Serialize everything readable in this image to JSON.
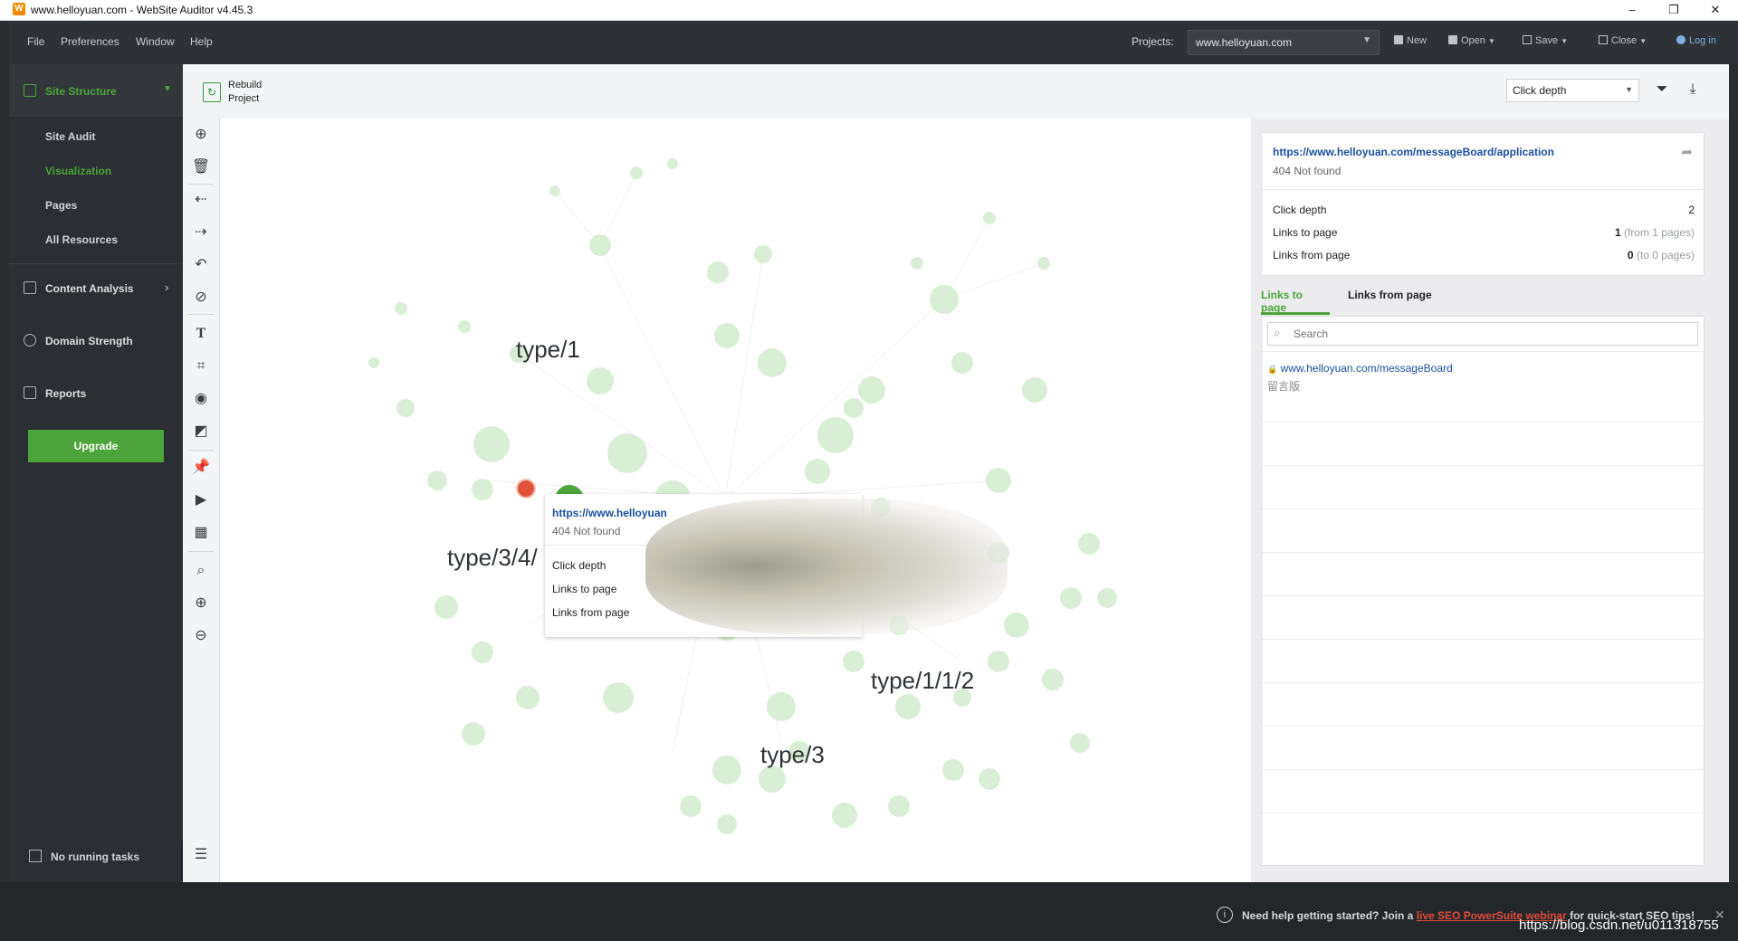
{
  "window": {
    "title": "www.helloyuan.com - WebSite Auditor v4.45.3",
    "app_icon": "W",
    "minimize_icon": "–",
    "restore_icon": "❐",
    "close_icon": "✕"
  },
  "menu": {
    "items": [
      "File",
      "Preferences",
      "Window",
      "Help"
    ],
    "projects_label": "Projects:",
    "project_value": "www.helloyuan.com",
    "toolbar": {
      "new": "New",
      "open": "Open",
      "save": "Save",
      "close": "Close",
      "login": "Log in"
    }
  },
  "sidebar": {
    "site_structure": "Site Structure",
    "sub_items": [
      "Site Audit",
      "Visualization",
      "Pages",
      "All Resources"
    ],
    "active_sub": "Visualization",
    "content_analysis": "Content Analysis",
    "domain_strength": "Domain Strength",
    "reports": "Reports",
    "upgrade": "Upgrade",
    "tasks": "No running tasks",
    "collapse_icon": "‹"
  },
  "header": {
    "rebuild": "Rebuild\nProject",
    "view_select": "Click depth"
  },
  "graph": {
    "labels": [
      "type/1",
      "type/3/4/",
      "type/1/1/2",
      "type/3"
    ],
    "tooltip": {
      "url": "https://www.helloyuan",
      "status": "404 Not found",
      "rows": [
        "Click depth",
        "Links to page",
        "Links from page"
      ]
    }
  },
  "details": {
    "url": "https://www.helloyuan.com/messageBoard/application",
    "status": "404 Not found",
    "rows": [
      {
        "label": "Click depth",
        "value": "2",
        "note": ""
      },
      {
        "label": "Links to page",
        "value": "1",
        "note": "(from 1 pages)"
      },
      {
        "label": "Links from page",
        "value": "0",
        "note": "(to 0 pages)"
      }
    ],
    "tabs": [
      "Links to page",
      "Links from page"
    ],
    "active_tab": "Links to page",
    "search_placeholder": "Search",
    "link_url": "www.helloyuan.com/messageBoard",
    "link_title": "留言版"
  },
  "status_bar": {
    "help_text": "Need help getting started? Join a",
    "link_text": "live SEO PowerSuite webinar",
    "help_suffix": "for quick-start SEO tips!",
    "watermark": "https://blog.csdn.net/u011318755"
  },
  "colors": {
    "accent_green": "#4ca43a",
    "node_green": "#d9efd5",
    "node_red": "#e0533a",
    "link_blue": "#1a4fa0"
  }
}
